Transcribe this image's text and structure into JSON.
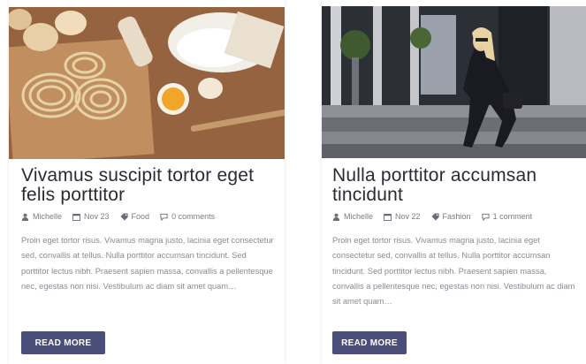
{
  "posts": [
    {
      "title": "Vivamus suscipit tortor eget felis porttitor",
      "author": "Michelle",
      "date": "Nov 23",
      "category": "Food",
      "comments": "0 comments",
      "excerpt": "Proin eget tortor risus. Vivamus magna justo, lacinia eget consectetur sed, convallis at tellus. Nulla porttitor accumsan tincidunt. Sed porttitor lectus nibh. Praesent sapien massa, convallis a pellentesque nec, egestas non nisi. Vestibulum ac diam sit amet quam…",
      "button": "READ MORE",
      "image": "baking-ingredients-photo"
    },
    {
      "title": "Nulla porttitor accumsan tincidunt",
      "author": "Michelle",
      "date": "Nov 22",
      "category": "Fashion",
      "comments": "1 comment",
      "excerpt": "Proin eget tortor risus. Vivamus magna justo, lacinia eget consectetur sed, convallis at tellus. Nulla porttitor accumsan tincidunt. Sed porttitor lectus nibh. Praesent sapien massa, convallis a pellentesque nec, egestas non nisi. Vestibulum ac diam sit amet quam…",
      "button": "READ MORE",
      "image": "fashion-model-on-steps-photo"
    }
  ],
  "icons": {
    "author": "user-icon",
    "date": "calendar-icon",
    "category": "tag-icon",
    "comments": "comment-icon"
  },
  "colors": {
    "button": "#4b4e79",
    "title": "#2b2b33",
    "meta": "#7a7a86",
    "excerpt": "#8a8a94"
  }
}
